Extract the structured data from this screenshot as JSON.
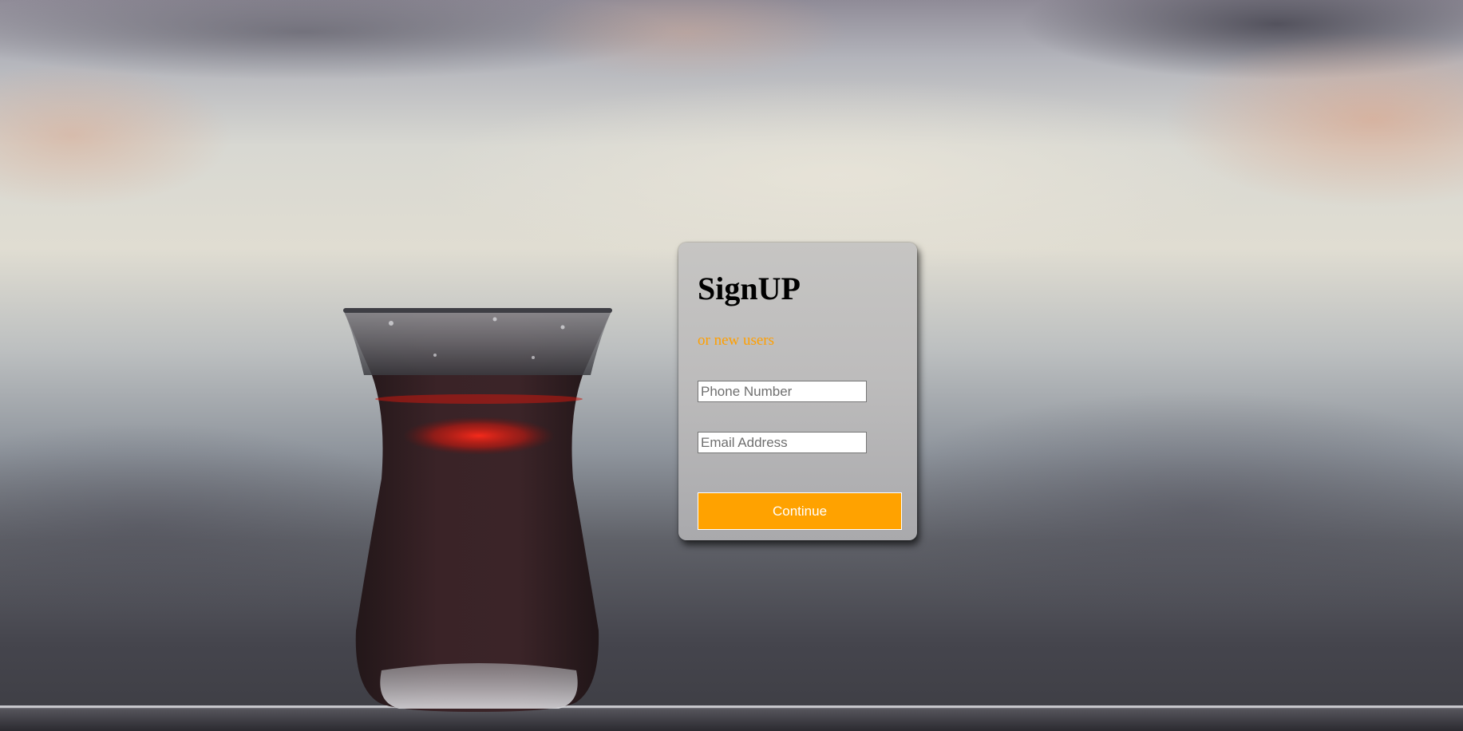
{
  "signup": {
    "title": "SignUP",
    "subtitle": "or new users",
    "phone_placeholder": "Phone Number",
    "email_placeholder": "Email Address",
    "continue_label": "Continue"
  },
  "colors": {
    "accent": "#ffa200",
    "subtitle": "#ff9f00",
    "tea": "#3a2024",
    "tea_highlight": "#ff2a1a"
  }
}
